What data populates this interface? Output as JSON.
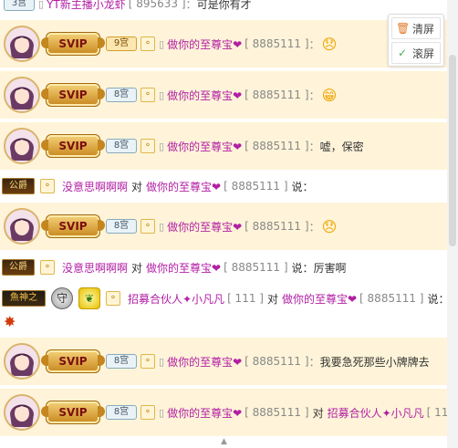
{
  "top_bar": {
    "level": "3宫",
    "user": "YT新主播小龙虾",
    "uid": "[ 895633 ]",
    "separator": "：",
    "message": "可是你有才"
  },
  "controls": {
    "clear_label": "清屏",
    "scroll_label": "滚屏"
  },
  "chat": [
    {
      "type": "svip",
      "svip": "SVIP",
      "level": "9宫",
      "user": "做你的至尊宝❤",
      "uid": "[ 8885111 ]",
      "separator": "：",
      "message": "",
      "emoji": "😞"
    },
    {
      "type": "svip",
      "svip": "SVIP",
      "level": "8宫",
      "user": "做你的至尊宝❤",
      "uid": "[ 8885111 ]",
      "separator": "：",
      "message": "",
      "emoji": "😁"
    },
    {
      "type": "svip",
      "svip": "SVIP",
      "level": "8宫",
      "user": "做你的至尊宝❤",
      "uid": "[ 8885111 ]",
      "separator": "：",
      "message": "嘘，保密",
      "emoji": ""
    },
    {
      "type": "gift",
      "rank": "公爵",
      "user": "没意思啊啊啊",
      "to_word": "对",
      "target": "做你的至尊宝❤",
      "uid": "[ 8885111 ]",
      "say": "说："
    },
    {
      "type": "svip",
      "svip": "SVIP",
      "level": "8宫",
      "user": "做你的至尊宝❤",
      "uid": "[ 8885111 ]",
      "separator": "：",
      "message": "",
      "emoji": "😞"
    },
    {
      "type": "gift",
      "rank": "公爵",
      "user": "没意思啊啊啊",
      "to_word": "对",
      "target": "做你的至尊宝❤",
      "uid": "[ 8885111 ]",
      "say": "说：",
      "message": "厉害啊"
    },
    {
      "type": "god",
      "rank": "魚神之",
      "shield": "守",
      "user": "招募合伙人✦小凡凡",
      "uid": "[ 111 ]",
      "to_word": "对",
      "target": "做你的至尊宝❤",
      "target_uid": "[ 8885111 ]",
      "say": "说："
    },
    {
      "type": "svip",
      "svip": "SVIP",
      "level": "8宫",
      "user": "做你的至尊宝❤",
      "uid": "[ 8885111 ]",
      "separator": "：",
      "message": "我要急死那些小牌牌去",
      "emoji": ""
    },
    {
      "type": "svip_to",
      "svip": "SVIP",
      "level": "8宫",
      "user": "做你的至尊宝❤",
      "uid": "[ 8885111 ]",
      "to_word": "对",
      "target": "招募合伙人✦小凡凡",
      "target_uid": "[ 111 ]"
    }
  ]
}
